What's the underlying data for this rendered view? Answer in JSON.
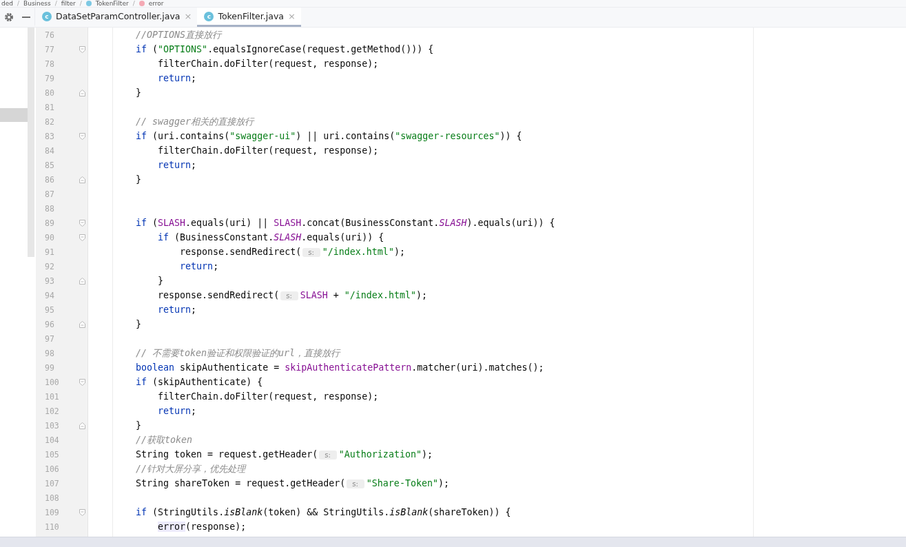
{
  "breadcrumb": [
    {
      "label": "ded",
      "kind": "plain"
    },
    {
      "label": "Business",
      "kind": "plain"
    },
    {
      "label": "filter",
      "kind": "plain"
    },
    {
      "label": "TokenFilter",
      "kind": "class"
    },
    {
      "label": "error",
      "kind": "method"
    }
  ],
  "breadcrumb_separator": "/",
  "tabs": [
    {
      "label": "DataSetParamController.java",
      "icon_letter": "c",
      "close": "×",
      "selected": false
    },
    {
      "label": "TokenFilter.java",
      "icon_letter": "c",
      "close": "×",
      "selected": true
    }
  ],
  "lines": [
    {
      "number": "76",
      "fold_start": false,
      "fold_end": false,
      "tokens": [
        {
          "kind": "comment",
          "text": "        //OPTIONS直接放行"
        }
      ]
    },
    {
      "number": "77",
      "fold_start": true,
      "fold_end": false,
      "tokens": [
        {
          "kind": "keyword",
          "text": "        if "
        },
        {
          "kind": "plain",
          "text": "("
        },
        {
          "kind": "string",
          "text": "\"OPTIONS\""
        },
        {
          "kind": "plain",
          "text": ".equalsIgnoreCase(request.getMethod())) {"
        }
      ]
    },
    {
      "number": "78",
      "fold_start": false,
      "fold_end": false,
      "tokens": [
        {
          "kind": "plain",
          "text": "            filterChain.doFilter(request, response);"
        }
      ]
    },
    {
      "number": "79",
      "fold_start": false,
      "fold_end": false,
      "tokens": [
        {
          "kind": "keyword",
          "text": "            return"
        },
        {
          "kind": "plain",
          "text": ";"
        }
      ]
    },
    {
      "number": "80",
      "fold_start": false,
      "fold_end": true,
      "tokens": [
        {
          "kind": "plain",
          "text": "        }"
        }
      ]
    },
    {
      "number": "81",
      "fold_start": false,
      "fold_end": false
    },
    {
      "number": "82",
      "fold_start": false,
      "fold_end": false,
      "tokens": [
        {
          "kind": "comment",
          "text": "        // swagger相关的直接放行"
        }
      ]
    },
    {
      "number": "83",
      "fold_start": true,
      "fold_end": false,
      "tokens": [
        {
          "kind": "keyword",
          "text": "        if "
        },
        {
          "kind": "plain",
          "text": "(uri.contains("
        },
        {
          "kind": "string",
          "text": "\"swagger-ui\""
        },
        {
          "kind": "plain",
          "text": ") || uri.contains("
        },
        {
          "kind": "string",
          "text": "\"swagger-resources\""
        },
        {
          "kind": "plain",
          "text": ")) {"
        }
      ]
    },
    {
      "number": "84",
      "fold_start": false,
      "fold_end": false,
      "tokens": [
        {
          "kind": "plain",
          "text": "            filterChain.doFilter(request, response);"
        }
      ]
    },
    {
      "number": "85",
      "fold_start": false,
      "fold_end": false,
      "tokens": [
        {
          "kind": "keyword",
          "text": "            return"
        },
        {
          "kind": "plain",
          "text": ";"
        }
      ]
    },
    {
      "number": "86",
      "fold_start": false,
      "fold_end": true,
      "tokens": [
        {
          "kind": "plain",
          "text": "        }"
        }
      ]
    },
    {
      "number": "87",
      "fold_start": false,
      "fold_end": false
    },
    {
      "number": "88",
      "fold_start": false,
      "fold_end": false
    },
    {
      "number": "89",
      "fold_start": true,
      "fold_end": false,
      "tokens": [
        {
          "kind": "keyword",
          "text": "        if "
        },
        {
          "kind": "plain",
          "text": "("
        },
        {
          "kind": "field",
          "text": "SLASH"
        },
        {
          "kind": "plain",
          "text": ".equals(uri) || "
        },
        {
          "kind": "field",
          "text": "SLASH"
        },
        {
          "kind": "plain",
          "text": ".concat(BusinessConstant."
        },
        {
          "kind": "static",
          "text": "SLASH"
        },
        {
          "kind": "plain",
          "text": ").equals(uri)) {"
        }
      ]
    },
    {
      "number": "90",
      "fold_start": true,
      "fold_end": false,
      "tokens": [
        {
          "kind": "keyword",
          "text": "            if "
        },
        {
          "kind": "plain",
          "text": "(BusinessConstant."
        },
        {
          "kind": "static",
          "text": "SLASH"
        },
        {
          "kind": "plain",
          "text": ".equals(uri)) {"
        }
      ]
    },
    {
      "number": "91",
      "fold_start": false,
      "fold_end": false,
      "tokens": [
        {
          "kind": "plain",
          "text": "                response.sendRedirect("
        },
        {
          "kind": "hint",
          "text": "s:"
        },
        {
          "kind": "string",
          "text": "\"/index.html\""
        },
        {
          "kind": "plain",
          "text": ");"
        }
      ]
    },
    {
      "number": "92",
      "fold_start": false,
      "fold_end": false,
      "tokens": [
        {
          "kind": "keyword",
          "text": "                return"
        },
        {
          "kind": "plain",
          "text": ";"
        }
      ]
    },
    {
      "number": "93",
      "fold_start": false,
      "fold_end": true,
      "tokens": [
        {
          "kind": "plain",
          "text": "            }"
        }
      ]
    },
    {
      "number": "94",
      "fold_start": false,
      "fold_end": false,
      "tokens": [
        {
          "kind": "plain",
          "text": "            response.sendRedirect("
        },
        {
          "kind": "hint",
          "text": "s:"
        },
        {
          "kind": "field",
          "text": "SLASH"
        },
        {
          "kind": "plain",
          "text": " + "
        },
        {
          "kind": "string",
          "text": "\"/index.html\""
        },
        {
          "kind": "plain",
          "text": ");"
        }
      ]
    },
    {
      "number": "95",
      "fold_start": false,
      "fold_end": false,
      "tokens": [
        {
          "kind": "keyword",
          "text": "            return"
        },
        {
          "kind": "plain",
          "text": ";"
        }
      ]
    },
    {
      "number": "96",
      "fold_start": false,
      "fold_end": true,
      "tokens": [
        {
          "kind": "plain",
          "text": "        }"
        }
      ]
    },
    {
      "number": "97",
      "fold_start": false,
      "fold_end": false
    },
    {
      "number": "98",
      "fold_start": false,
      "fold_end": false,
      "tokens": [
        {
          "kind": "comment",
          "text": "        // 不需要token验证和权限验证的url，直接放行"
        }
      ]
    },
    {
      "number": "99",
      "fold_start": false,
      "fold_end": false,
      "tokens": [
        {
          "kind": "keyword",
          "text": "        boolean "
        },
        {
          "kind": "plain",
          "text": "skipAuthenticate = "
        },
        {
          "kind": "field",
          "text": "skipAuthenticatePattern"
        },
        {
          "kind": "plain",
          "text": ".matcher(uri).matches();"
        }
      ]
    },
    {
      "number": "100",
      "fold_start": true,
      "fold_end": false,
      "tokens": [
        {
          "kind": "keyword",
          "text": "        if "
        },
        {
          "kind": "plain",
          "text": "(skipAuthenticate) {"
        }
      ]
    },
    {
      "number": "101",
      "fold_start": false,
      "fold_end": false,
      "tokens": [
        {
          "kind": "plain",
          "text": "            filterChain.doFilter(request, response);"
        }
      ]
    },
    {
      "number": "102",
      "fold_start": false,
      "fold_end": false,
      "tokens": [
        {
          "kind": "keyword",
          "text": "            return"
        },
        {
          "kind": "plain",
          "text": ";"
        }
      ]
    },
    {
      "number": "103",
      "fold_start": false,
      "fold_end": true,
      "tokens": [
        {
          "kind": "plain",
          "text": "        }"
        }
      ]
    },
    {
      "number": "104",
      "fold_start": false,
      "fold_end": false,
      "tokens": [
        {
          "kind": "comment",
          "text": "        //获取token"
        }
      ]
    },
    {
      "number": "105",
      "fold_start": false,
      "fold_end": false,
      "tokens": [
        {
          "kind": "plain",
          "text": "        String token = request.getHeader("
        },
        {
          "kind": "hint",
          "text": "s:"
        },
        {
          "kind": "string",
          "text": "\"Authorization\""
        },
        {
          "kind": "plain",
          "text": ");"
        }
      ]
    },
    {
      "number": "106",
      "fold_start": false,
      "fold_end": false,
      "tokens": [
        {
          "kind": "comment",
          "text": "        //针对大屏分享，优先处理"
        }
      ]
    },
    {
      "number": "107",
      "fold_start": false,
      "fold_end": false,
      "tokens": [
        {
          "kind": "plain",
          "text": "        String shareToken = request.getHeader("
        },
        {
          "kind": "hint",
          "text": "s:"
        },
        {
          "kind": "string",
          "text": "\"Share-Token\""
        },
        {
          "kind": "plain",
          "text": ");"
        }
      ]
    },
    {
      "number": "108",
      "fold_start": false,
      "fold_end": false
    },
    {
      "number": "109",
      "fold_start": true,
      "fold_end": false,
      "tokens": [
        {
          "kind": "keyword",
          "text": "        if "
        },
        {
          "kind": "plain",
          "text": "(StringUtils."
        },
        {
          "kind": "static-method",
          "text": "isBlank"
        },
        {
          "kind": "plain",
          "text": "(token) && StringUtils."
        },
        {
          "kind": "static-method",
          "text": "isBlank"
        },
        {
          "kind": "plain",
          "text": "(shareToken)) {"
        }
      ]
    },
    {
      "number": "110",
      "fold_start": false,
      "fold_end": false,
      "tokens": [
        {
          "kind": "highlight",
          "text": "            error"
        },
        {
          "kind": "plain",
          "text": "(response);"
        }
      ]
    }
  ]
}
